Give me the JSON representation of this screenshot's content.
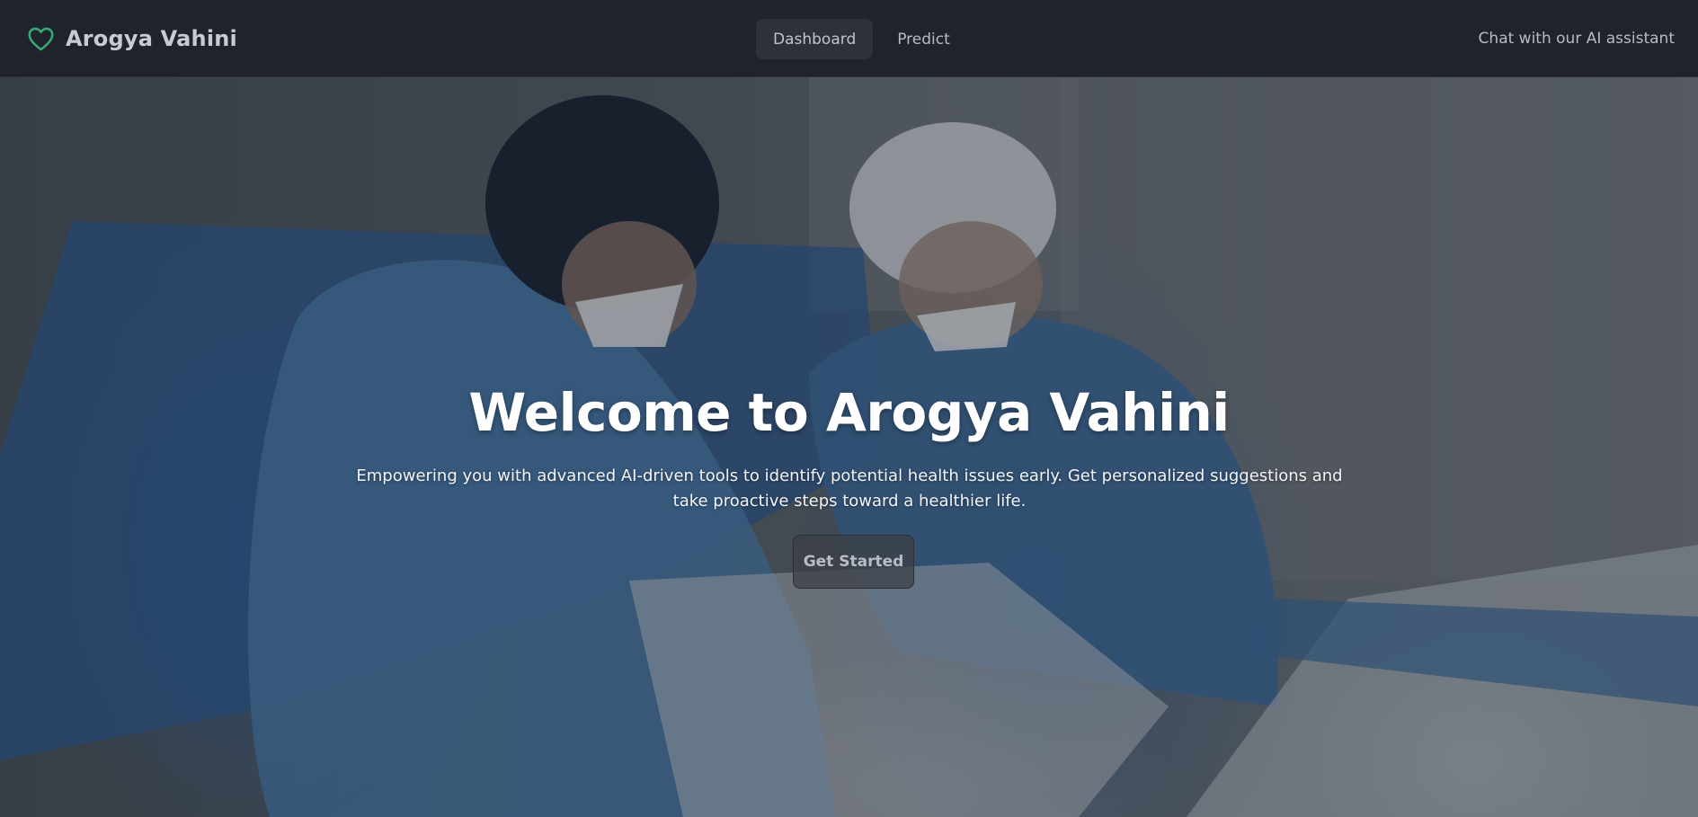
{
  "nav": {
    "brand": "Arogya Vahini",
    "tabs": [
      {
        "label": "Dashboard",
        "active": true
      },
      {
        "label": "Predict",
        "active": false
      }
    ],
    "chat_link": "Chat with our AI assistant"
  },
  "hero": {
    "title": "Welcome to Arogya Vahini",
    "subtitle": "Empowering you with advanced AI-driven tools to identify potential health issues early. Get personalized suggestions and take proactive steps toward a healthier life.",
    "cta_label": "Get Started"
  },
  "colors": {
    "navbar_bg": "#1f232b",
    "heart_icon": "#3aa876",
    "text_primary": "#ffffff"
  }
}
